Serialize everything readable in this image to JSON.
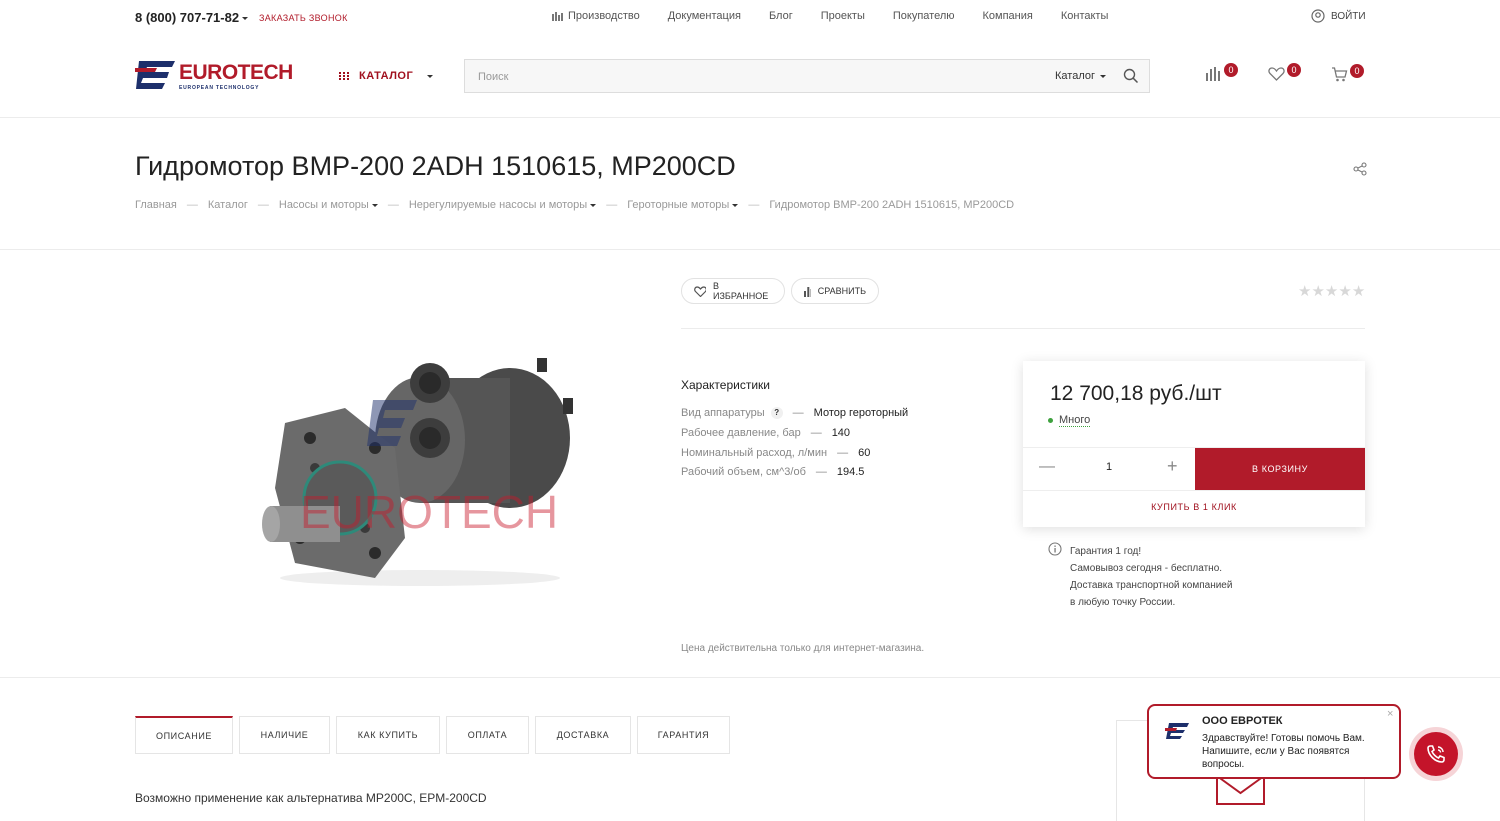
{
  "topbar": {
    "phone": "8 (800) 707-71-82",
    "callback": "ЗАКАЗАТЬ ЗВОНОК",
    "nav": [
      "Производство",
      "Документация",
      "Блог",
      "Проекты",
      "Покупателю",
      "Компания",
      "Контакты"
    ],
    "login": "ВОЙТИ"
  },
  "header": {
    "logo_text": "EUROTECH",
    "logo_sub": "EUROPEAN TECHNOLOGY",
    "catalog": "КАТАЛОГ",
    "search_placeholder": "Поиск",
    "search_scope": "Каталог",
    "compare_count": "0",
    "favorites_count": "0",
    "cart_count": "0"
  },
  "page": {
    "title": "Гидромотор BMP-200 2ADH 1510615, MP200CD",
    "breadcrumbs": [
      "Главная",
      "Каталог",
      "Насосы и моторы",
      "Нерегулируемые насосы и моторы",
      "Героторные моторы",
      "Гидромотор BMP-200 2ADH 1510615, MP200CD"
    ]
  },
  "product": {
    "favorite_label": "В ИЗБРАННОЕ",
    "compare_label": "СРАВНИТЬ",
    "rating": 0,
    "image_watermark": "EUROTECH",
    "specs_title": "Характеристики",
    "specs": [
      {
        "name": "Вид аппаратуры",
        "value": "Мотор героторный",
        "help": "?"
      },
      {
        "name": "Рабочее давление, бар",
        "value": "140"
      },
      {
        "name": "Номинальный расход, л/мин",
        "value": "60"
      },
      {
        "name": "Рабочий объем, см^3/об",
        "value": "194.5"
      }
    ],
    "price": "12 700,18 руб./шт",
    "stock": "Много",
    "quantity": "1",
    "to_cart": "В КОРЗИНУ",
    "one_click": "КУПИТЬ В 1 КЛИК",
    "info_lines": [
      "Гарантия 1 год!",
      "Самовывоз сегодня - бесплатно.",
      "Доставка транспортной компанией",
      "в любую точку России."
    ],
    "price_note": "Цена действительна только для интернет-магазина."
  },
  "tabs": [
    "ОПИСАНИЕ",
    "НАЛИЧИЕ",
    "КАК КУПИТЬ",
    "ОПЛАТА",
    "ДОСТАВКА",
    "ГАРАНТИЯ"
  ],
  "description": "Возможно применение как альтернатива MP200C, EPM-200CD",
  "chat": {
    "title": "ООО ЕВРОТЕК",
    "text": "Здравствуйте! Готовы помочь Вам. Напишите, если у Вас появятся вопросы.",
    "close": "×"
  },
  "colors": {
    "brand_red": "#b11b2a",
    "logo_navy": "#1d2f6b",
    "stock_green": "#3ea13e"
  }
}
